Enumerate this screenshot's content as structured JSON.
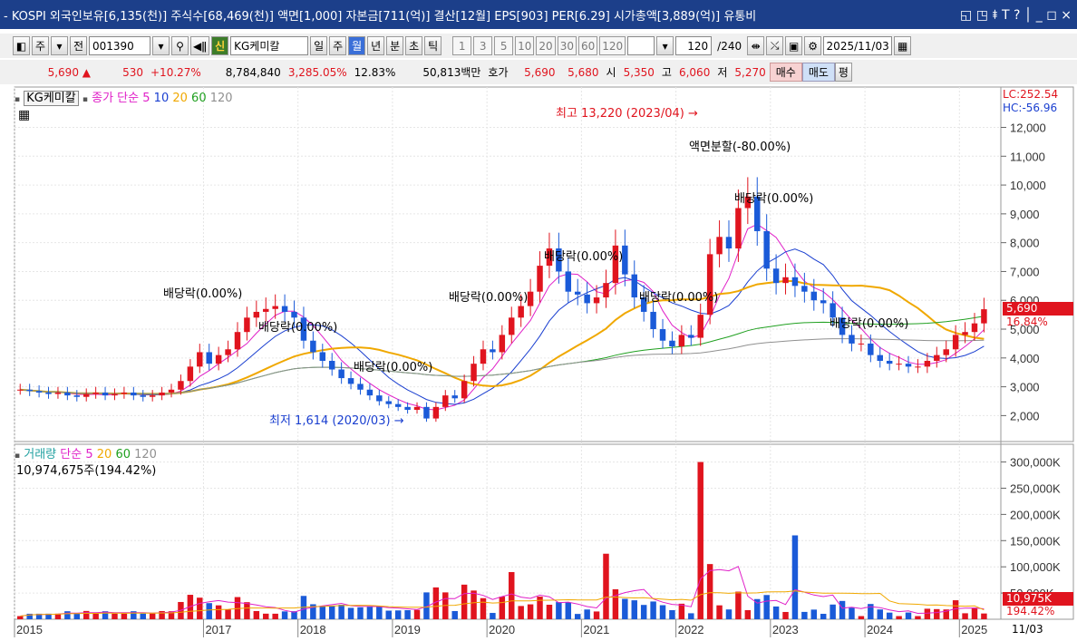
{
  "titlebar": {
    "text": "- KOSPI 외국인보유[6,135(천)] 주식수[68,469(천)] 액면[1,000] 자본금[711(억)] 결산[12월] EPS[903] PER[6.29] 시가총액[3,889(억)] 유통비",
    "icons": "◱ ◳ ⯒ T ? │ _ ◻ ×"
  },
  "toolbar": {
    "type_select": "주",
    "all_label": "전",
    "code": "001390",
    "new_label": "신",
    "stock_name": "KG케미칼",
    "periods": [
      "일",
      "주",
      "월",
      "년",
      "분",
      "초",
      "틱"
    ],
    "selected_period": "월",
    "minute_values": [
      "1",
      "3",
      "5",
      "10",
      "20",
      "30",
      "60",
      "120"
    ],
    "count": "120",
    "count_total": "/240",
    "date": "2025/11/03"
  },
  "quote": {
    "price": "5,690",
    "change": "530",
    "change_pct": "+10.27%",
    "volume": "8,784,840",
    "vol_ratio": "3,285.05%",
    "turnover": "12.83%",
    "amount": "50,813백만",
    "hoga_label": "호가",
    "ask": "5,690",
    "bid": "5,680",
    "open_label": "시",
    "open": "5,350",
    "high_label": "고",
    "high": "6,060",
    "low_label": "저",
    "low": "5,270",
    "buy_label": "매수",
    "sell_label": "매도",
    "eval_label": "평"
  },
  "price_legend": {
    "name": "KG케미칼",
    "ma_label": "종가 단순",
    "ma": [
      "5",
      "10",
      "20",
      "60",
      "120"
    ]
  },
  "volume_legend": {
    "name": "거래량",
    "ma_label": "단순",
    "ma": [
      "5",
      "20",
      "60",
      "120"
    ],
    "value": "10,974,675주(194.42%)"
  },
  "annotations": {
    "high": "최고 13,220 (2023/04)",
    "low": "최저 1,614 (2020/03)",
    "split": "액면분할(-80.00%)",
    "dividends": [
      "배당락(0.00%)",
      "배당락(0.00%)",
      "배당락(0.00%)",
      "배당락(0.00%)",
      "배당락(0.00%)",
      "배당락(0.00%)",
      "배당락(0.00%)",
      "배당락(0.00%)"
    ]
  },
  "right_axis": {
    "lc": "LC:252.54",
    "hc": "HC:-56.96",
    "current_price": "5,690",
    "current_pct": "16.84%",
    "current_vol": "10,975K",
    "current_vol_pct": "194.42%",
    "date": "11/03"
  },
  "colors": {
    "up": "#e0141e",
    "down": "#1a5ad8",
    "ma5": "#e020c8",
    "ma10": "#1a3fd0",
    "ma20": "#f0a800",
    "ma60": "#20a020",
    "ma120": "#909090"
  },
  "chart_data": [
    {
      "type": "candlestick",
      "title": "KG케미칼 월봉",
      "yticks": [
        2000,
        3000,
        4000,
        5000,
        6000,
        7000,
        8000,
        9000,
        10000,
        11000,
        12000
      ],
      "ylim": [
        1100,
        13400
      ],
      "x_labels": [
        "2015",
        "2017",
        "2018",
        "2019",
        "2020",
        "2021",
        "2022",
        "2023",
        "2024",
        "2025"
      ],
      "series": [
        {
          "name": "종가",
          "values": [
            2900,
            2850,
            2800,
            2750,
            2800,
            2700,
            2650,
            2750,
            2800,
            2700,
            2750,
            2800,
            2700,
            2650,
            2700,
            2800,
            2900,
            3200,
            3700,
            4200,
            3800,
            4100,
            4300,
            4900,
            5400,
            5600,
            5700,
            5800,
            5600,
            5400,
            4600,
            4200,
            3900,
            3600,
            3300,
            3100,
            2900,
            2700,
            2500,
            2400,
            2300,
            2200,
            2300,
            1900,
            2300,
            2700,
            2600,
            3200,
            3800,
            4300,
            4200,
            4800,
            5400,
            5800,
            6300,
            7200,
            7800,
            7000,
            6300,
            6200,
            5900,
            6100,
            6600,
            7900,
            6900,
            6100,
            5600,
            5000,
            4600,
            4400,
            4800,
            4700,
            5500,
            7600,
            8200,
            7800,
            9200,
            9600,
            8400,
            7100,
            6600,
            6800,
            6500,
            6300,
            6000,
            5900,
            5400,
            4800,
            4500,
            4500,
            4100,
            3900,
            3800,
            3800,
            3700,
            3700,
            3900,
            4100,
            4300,
            4800,
            4900,
            5200,
            5690
          ]
        }
      ],
      "annotations": [
        "최고 13,220 (2023/04)",
        "최저 1,614 (2020/03)",
        "액면분할(-80.00%)"
      ]
    },
    {
      "type": "bar",
      "title": "거래량",
      "yticks_label": [
        "50,000K",
        "100,000K",
        "150,000K",
        "200,000K",
        "250,000K",
        "300,000K"
      ],
      "ylim": [
        0,
        320000
      ],
      "peaks": [
        {
          "x": "2022",
          "value": 300000
        },
        {
          "x": "2023",
          "value": 160000
        },
        {
          "x": "2021",
          "value": 125000
        },
        {
          "x": "2020",
          "value": 90000
        }
      ],
      "last_value": 10975
    }
  ]
}
